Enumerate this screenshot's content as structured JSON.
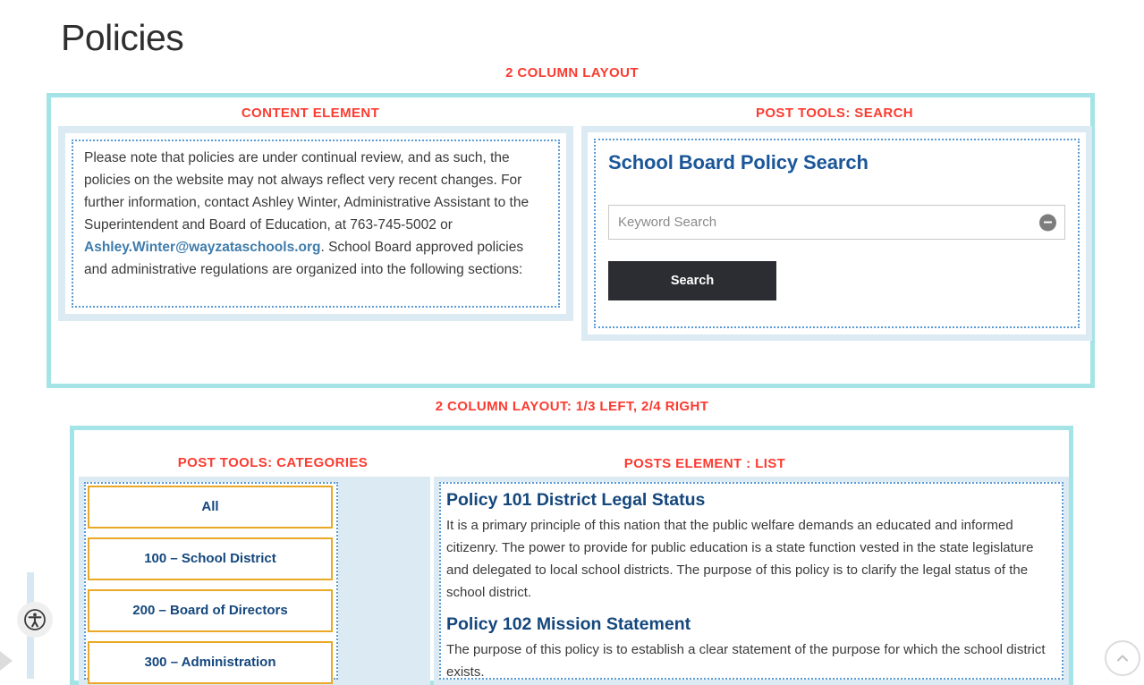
{
  "page": {
    "title": "Policies"
  },
  "colors": {
    "builder_label": "#fb3b30",
    "section_border": "#a4e4e6",
    "column_wrapper": "#dbeaf3",
    "element_outline": "#5b9bd5",
    "heading_blue": "#14477d",
    "link_blue": "#3f7cac",
    "category_border": "#e9a825",
    "search_button_bg": "#2b2d32"
  },
  "section_one": {
    "layout_label": "2 COLUMN LAYOUT",
    "content_column": {
      "element_label": "CONTENT ELEMENT",
      "paragraph_before_link": "Please note that policies are under continual review, and as such, the policies on the website may not always reflect very recent changes. For further information, contact Ashley Winter, Administrative Assistant to the Superintendent and Board of Education, at 763-745-5002 or ",
      "email_link": "Ashley.Winter@wayzataschools.org",
      "paragraph_after_link": ". School Board approved policies and administrative regulations are organized into the following sections:"
    },
    "search_column": {
      "element_label": "POST TOOLS: SEARCH",
      "title": "School Board Policy Search",
      "keyword_placeholder": "Keyword Search",
      "keyword_value": "",
      "clear_icon": "minus-circle-icon",
      "search_button_label": "Search"
    }
  },
  "section_two": {
    "layout_label": "2 COLUMN LAYOUT: 1/3 LEFT, 2/4 RIGHT",
    "categories_column": {
      "element_label": "POST TOOLS: CATEGORIES",
      "items": [
        {
          "label": "All"
        },
        {
          "label": "100 – School District"
        },
        {
          "label": "200 – Board of Directors"
        },
        {
          "label": "300 – Administration"
        }
      ]
    },
    "posts_column": {
      "element_label": "POSTS ELEMENT : LIST",
      "posts": [
        {
          "title": "Policy 101 District Legal Status",
          "body": "It is a primary principle of this nation that the public welfare demands an educated and informed citizenry. The power to provide for public education is a state function vested in the state legislature and delegated to local school districts. The purpose of this policy is to clarify the legal status of the school district."
        },
        {
          "title": "Policy 102 Mission Statement",
          "body": "The purpose of this policy is to establish a clear statement of the purpose for which the school district exists."
        }
      ]
    }
  },
  "widgets": {
    "accessibility_icon": "accessibility-icon",
    "side_tab_icon": "chevron-right-icon",
    "scroll_top_icon": "chevron-up-icon"
  }
}
